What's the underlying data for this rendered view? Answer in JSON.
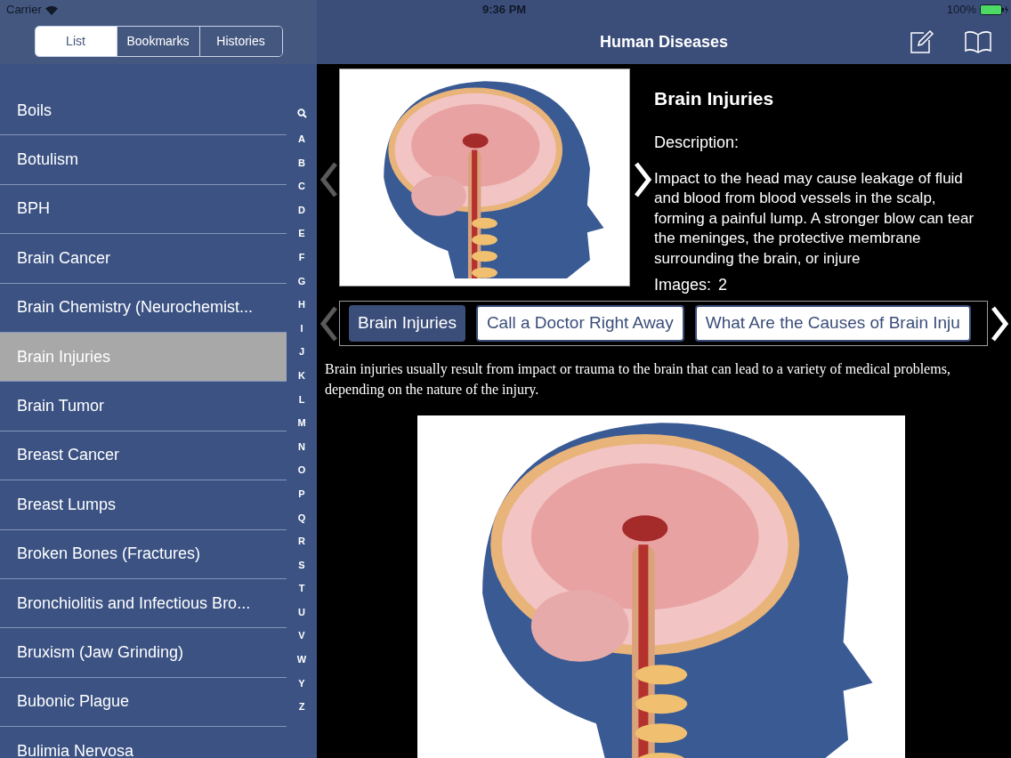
{
  "status_bar": {
    "carrier": "Carrier",
    "time": "9:36 PM",
    "battery": "100%"
  },
  "segments": [
    {
      "label": "List",
      "selected": true
    },
    {
      "label": "Bookmarks",
      "selected": false
    },
    {
      "label": "Histories",
      "selected": false
    }
  ],
  "title": "Human Diseases",
  "list": [
    {
      "label": "Boils",
      "selected": false
    },
    {
      "label": "Botulism",
      "selected": false
    },
    {
      "label": "BPH",
      "selected": false
    },
    {
      "label": "Brain Cancer",
      "selected": false
    },
    {
      "label": "Brain Chemistry (Neurochemist...",
      "selected": false
    },
    {
      "label": "Brain Injuries",
      "selected": true
    },
    {
      "label": "Brain Tumor",
      "selected": false
    },
    {
      "label": "Breast Cancer",
      "selected": false
    },
    {
      "label": "Breast Lumps",
      "selected": false
    },
    {
      "label": "Broken Bones (Fractures)",
      "selected": false
    },
    {
      "label": "Bronchiolitis and Infectious Bro...",
      "selected": false
    },
    {
      "label": "Bruxism (Jaw Grinding)",
      "selected": false
    },
    {
      "label": "Bubonic Plague",
      "selected": false
    },
    {
      "label": "Bulimia Nervosa",
      "selected": false
    }
  ],
  "index": [
    "A",
    "B",
    "C",
    "D",
    "E",
    "F",
    "G",
    "H",
    "I",
    "J",
    "K",
    "L",
    "M",
    "N",
    "O",
    "P",
    "Q",
    "R",
    "S",
    "T",
    "U",
    "V",
    "W",
    "Y",
    "Z"
  ],
  "detail": {
    "heading": "Brain Injuries",
    "description_label": "Description:",
    "description": "Impact to the head may cause leakage of fluid and blood from blood vessels in the scalp, forming a painful lump. A stronger blow can tear the meninges, the protective membrane surrounding the brain, or injure",
    "images_label": "Images:",
    "images_count": "2"
  },
  "chips": [
    {
      "label": "Brain Injuries",
      "selected": true
    },
    {
      "label": "Call a Doctor Right Away",
      "selected": false
    },
    {
      "label": "What Are the Causes of Brain Inju",
      "selected": false
    }
  ],
  "paragraph": "Brain injuries usually result from impact or trauma to the brain that can lead to a variety of medical problems, depending on the nature of the injury."
}
